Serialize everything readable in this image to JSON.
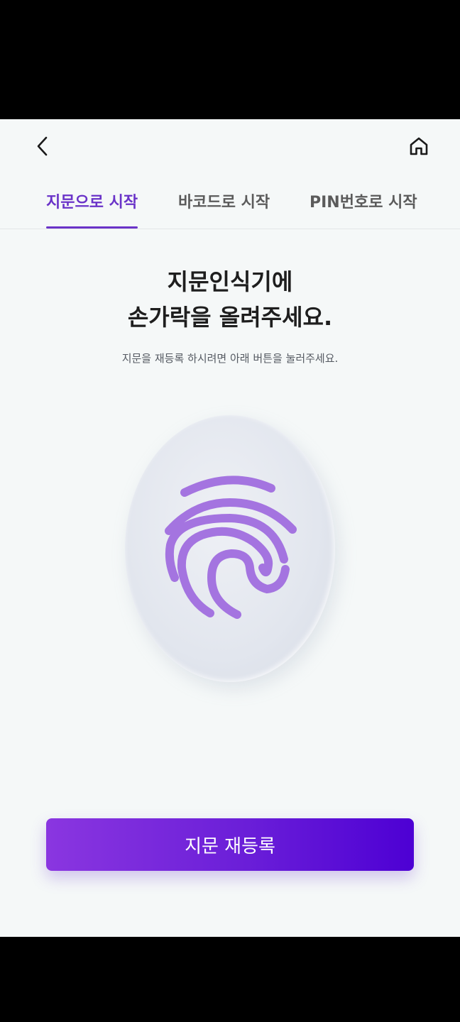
{
  "header": {
    "back_icon": "chevron-left-icon",
    "home_icon": "home-icon"
  },
  "tabs": [
    {
      "label": "지문으로 시작",
      "active": true
    },
    {
      "label": "바코드로 시작",
      "active": false
    },
    {
      "label": "PIN번호로 시작",
      "active": false
    }
  ],
  "main": {
    "title_line1": "지문인식기에",
    "title_line2": "손가락을 올려주세요.",
    "subtitle": "지문을 재등록 하시려면 아래 버튼을 눌러주세요.",
    "fingerprint_icon": "fingerprint-icon",
    "fingerprint_color": "#a474e0"
  },
  "cta": {
    "label": "지문 재등록"
  },
  "colors": {
    "accent": "#6a33c8",
    "button_start": "#8a36e0",
    "button_end": "#4d00d4",
    "background": "#f5f8f8"
  }
}
